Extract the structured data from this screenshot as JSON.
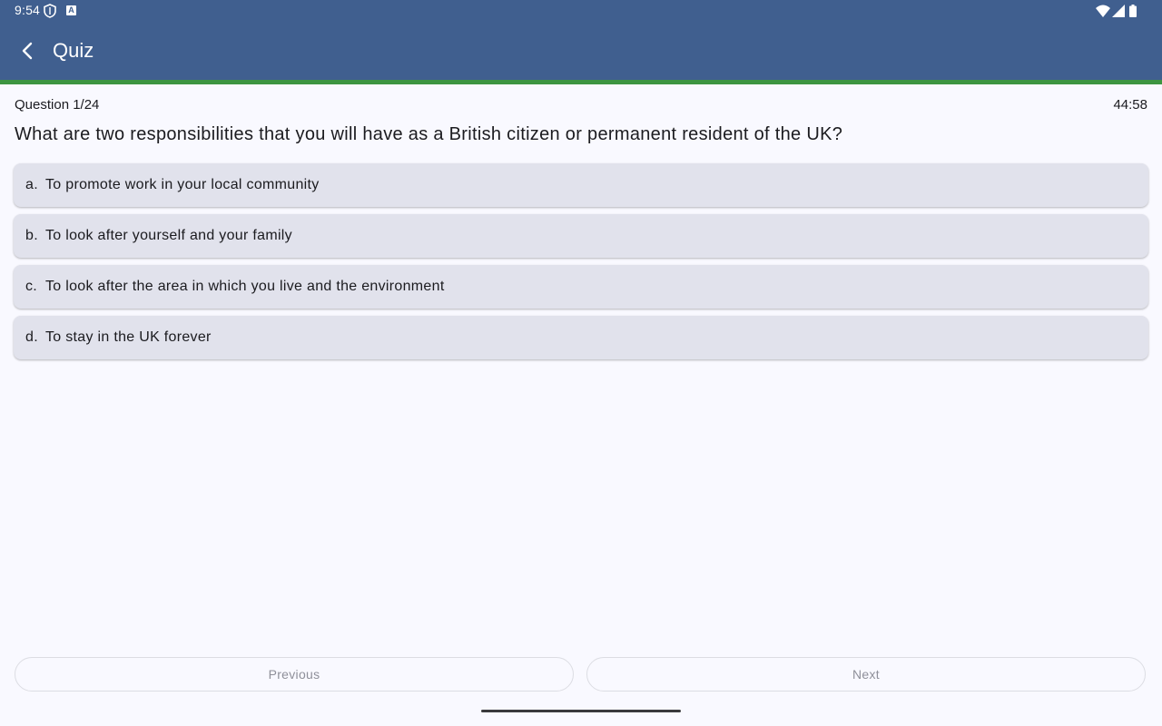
{
  "status_bar": {
    "time": "9:54",
    "a_badge": "A",
    "icons": [
      "shield-icon",
      "a-badge-icon",
      "wifi-icon",
      "signal-icon",
      "battery-icon"
    ]
  },
  "app_bar": {
    "title": "Quiz",
    "back_icon": "chevron-left-icon"
  },
  "progress": {
    "fraction": 1.0
  },
  "quiz": {
    "counter": "Question 1/24",
    "timer": "44:58",
    "question": "What are two responsibilities that you will have as a British citizen or permanent resident of the UK?",
    "options": [
      {
        "letter": "a.",
        "text": "To promote work in your local community"
      },
      {
        "letter": "b.",
        "text": "To look after yourself and your family"
      },
      {
        "letter": "c.",
        "text": "To look after the area in which you live and the environment"
      },
      {
        "letter": "d.",
        "text": "To stay in the UK forever"
      }
    ]
  },
  "navigation": {
    "previous_label": "Previous",
    "next_label": "Next"
  },
  "colors": {
    "app_bar": "#405f8f",
    "progress": "#3d9541",
    "option_bg": "#e1e2ec",
    "background": "#f9f9ff"
  }
}
